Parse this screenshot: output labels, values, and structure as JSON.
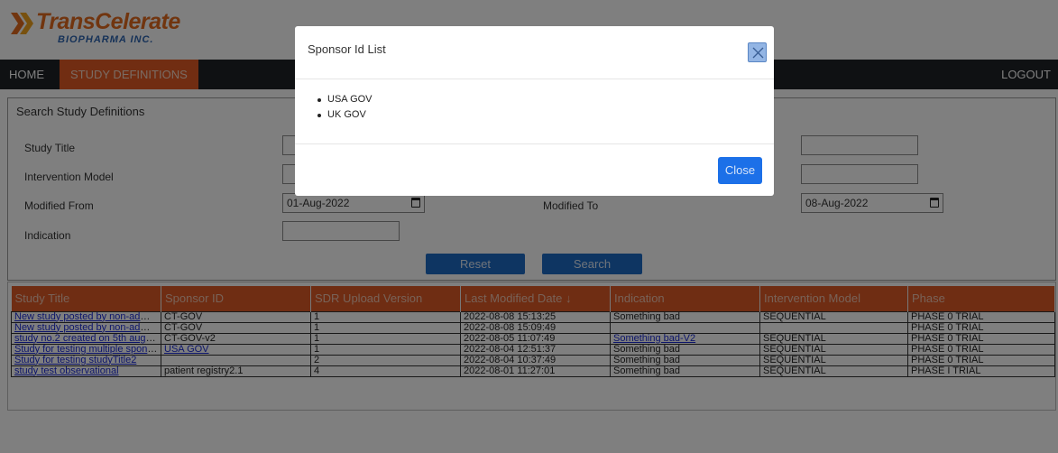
{
  "brand": {
    "name": "TransCelerate",
    "subtitle": "BIOPHARMA INC.",
    "primary_color": "#e36a1e",
    "secondary_color": "#2d64b0"
  },
  "nav": {
    "home": "HOME",
    "study_definitions": "STUDY DEFINITIONS",
    "logout": "LOGOUT"
  },
  "search": {
    "title": "Search Study Definitions",
    "study_title_label": "Study Title",
    "intervention_model_label": "Intervention Model",
    "modified_from_label": "Modified From",
    "modified_from_value": "01-Aug-2022",
    "modified_to_label": "Modified To",
    "modified_to_value": "08-Aug-2022",
    "indication_label": "Indication",
    "reset_label": "Reset",
    "search_label": "Search"
  },
  "table": {
    "header_color": "#de5a26",
    "columns": [
      "Study Title",
      "Sponsor ID",
      "SDR Upload Version",
      "Last Modified Date ↓",
      "Indication",
      "Intervention Model",
      "Phase"
    ],
    "rows": [
      [
        "New study posted by non-admin...",
        "CT-GOV",
        "1",
        "2022-08-08 15:13:25",
        "Something bad",
        "SEQUENTIAL",
        "PHASE 0 TRIAL"
      ],
      [
        "New study posted by non-admin...",
        "CT-GOV",
        "1",
        "2022-08-08 15:09:49",
        "",
        "",
        "PHASE 0 TRIAL"
      ],
      [
        "study no.2 created on 5th august",
        "CT-GOV-v2",
        "1",
        "2022-08-05 11:07:49",
        "Something bad-V2",
        "SEQUENTIAL",
        "PHASE 0 TRIAL"
      ],
      [
        "Study for testing multiple spons...",
        "USA GOV",
        "1",
        "2022-08-04 12:51:37",
        "Something bad",
        "SEQUENTIAL",
        "PHASE 0 TRIAL"
      ],
      [
        "Study for testing studyTitle2",
        "",
        "2",
        "2022-08-04 10:37:49",
        "Something bad",
        "SEQUENTIAL",
        "PHASE 0 TRIAL"
      ],
      [
        "study test observational",
        "patient registry2.1",
        "4",
        "2022-08-01 11:27:01",
        "Something bad",
        "SEQUENTIAL",
        "PHASE I TRIAL"
      ]
    ]
  },
  "modal": {
    "title": "Sponsor Id List",
    "items": [
      "USA GOV",
      "UK GOV"
    ],
    "close_label": "Close",
    "close_icon": "close-icon"
  }
}
